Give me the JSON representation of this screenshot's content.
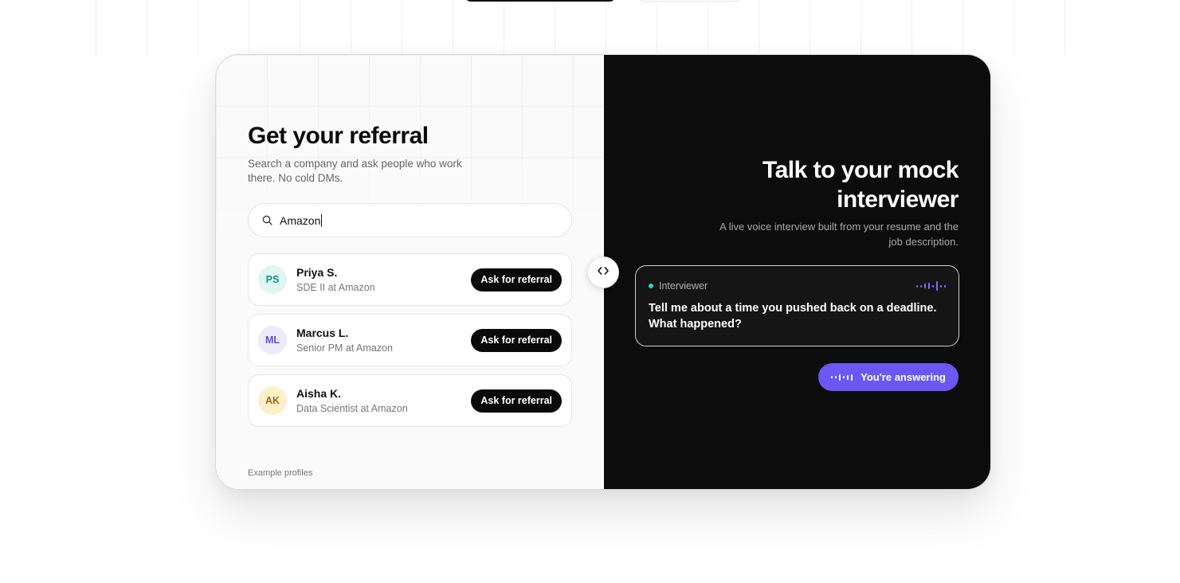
{
  "referral": {
    "title": "Get your referral",
    "subtitle": "Search a company and ask people who work there. No cold DMs.",
    "search": {
      "value": "Amazon",
      "icon": "search-icon"
    },
    "people": [
      {
        "initials": "PS",
        "name": "Priya S.",
        "role": "SDE II at Amazon",
        "button": "Ask for referral",
        "avatar_bg": "#dff6f3",
        "avatar_fg": "#1f8f83"
      },
      {
        "initials": "ML",
        "name": "Marcus L.",
        "role": "Senior PM at Amazon",
        "button": "Ask for referral",
        "avatar_bg": "#ecebfc",
        "avatar_fg": "#5b4fd6"
      },
      {
        "initials": "AK",
        "name": "Aisha K.",
        "role": "Data Scientist at Amazon",
        "button": "Ask for referral",
        "avatar_bg": "#fdf0c9",
        "avatar_fg": "#9a6a12"
      }
    ],
    "footnote": "Example profiles"
  },
  "interview": {
    "title": "Talk to your mock interviewer",
    "subtitle": "A live voice interview built from your resume and the job description.",
    "card": {
      "label": "Interviewer",
      "question": "Tell me about a time you pushed back on a deadline. What happened?",
      "status_color": "#2dd4bf"
    },
    "answer_pill": {
      "label": "You're answering",
      "color": "#6c56f4"
    }
  },
  "divider": {
    "icon": "code-arrows-icon"
  },
  "colors": {
    "dark_panel": "#0c0c0c",
    "light_panel": "#fafafa",
    "accent": "#6c56f4"
  }
}
